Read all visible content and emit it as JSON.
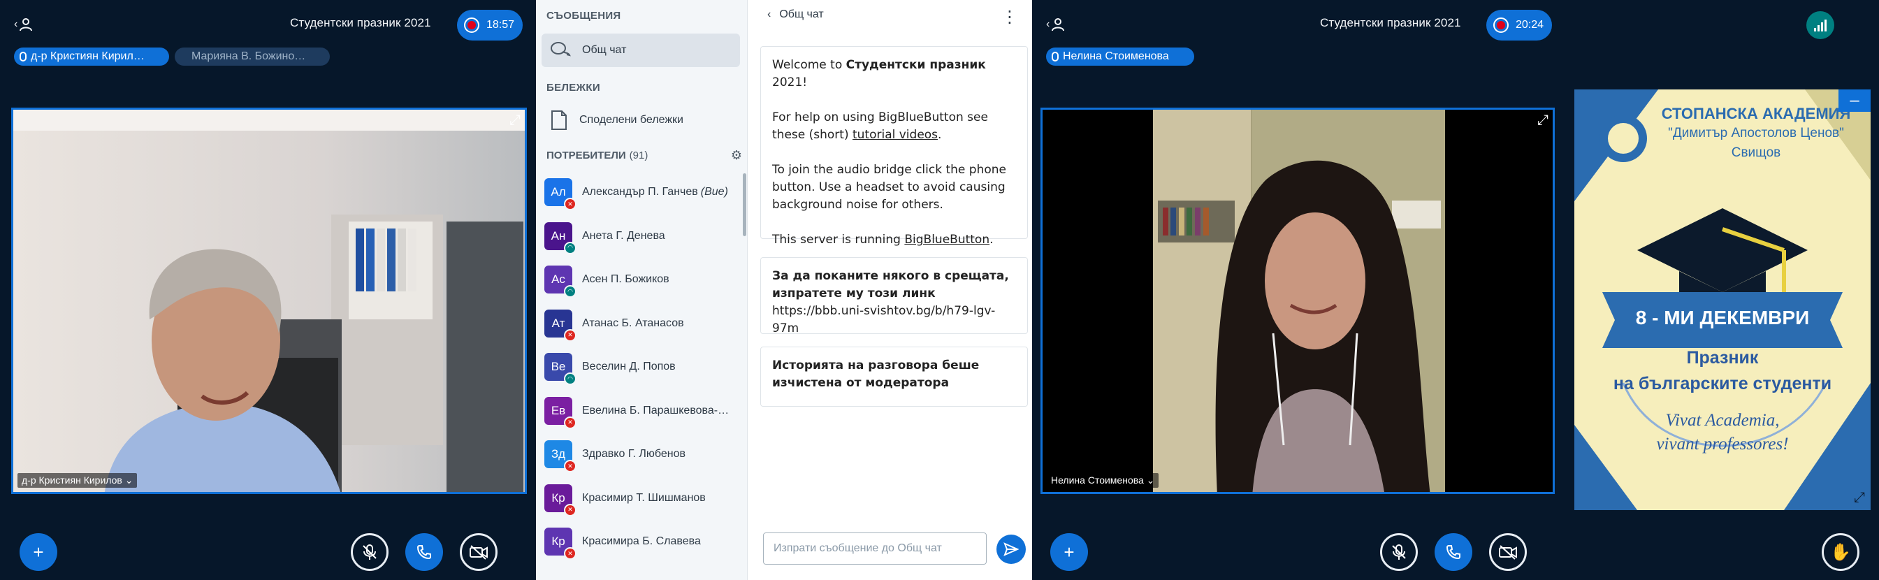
{
  "colors": {
    "primary": "#0f70d7",
    "background": "#06172a",
    "muted": "#de2721",
    "listen": "#008081"
  },
  "left_meeting": {
    "title": "Студентски празник 2021",
    "timer": "18:57",
    "talkers": [
      {
        "name": "д-р Кристиян Кирил…"
      },
      {
        "name": "Марияна В. Божино…"
      }
    ],
    "video_name": "д-р Кристиян Кирилов"
  },
  "sidebar": {
    "messages_section": "СЪОБЩЕНИЯ",
    "public_chat": "Общ чат",
    "notes_section": "БЕЛЕЖКИ",
    "shared_notes": "Споделени бележки",
    "users_section": "ПОТРЕБИТЕЛИ",
    "users_count": "(91)",
    "users": [
      {
        "initials": "Ал",
        "name": "Александър П. Ганчев",
        "suffix": "(Вие)",
        "color": "#1a73e8",
        "status": "muted"
      },
      {
        "initials": "Ан",
        "name": "Анета Г. Денева",
        "suffix": "",
        "color": "#4a148c",
        "status": "listen"
      },
      {
        "initials": "Ас",
        "name": "Асен П. Божиков",
        "suffix": "",
        "color": "#5e35b1",
        "status": "listen"
      },
      {
        "initials": "Ат",
        "name": "Атанас Б. Атанасов",
        "suffix": "",
        "color": "#283593",
        "status": "muted"
      },
      {
        "initials": "Ве",
        "name": "Веселин Д. Попов",
        "suffix": "",
        "color": "#3949ab",
        "status": "listen"
      },
      {
        "initials": "Ев",
        "name": "Евелина Б. Парашкевова-В…",
        "suffix": "",
        "color": "#7b1fa2",
        "status": "muted"
      },
      {
        "initials": "Зд",
        "name": "Здравко Г. Любенов",
        "suffix": "",
        "color": "#1e88e5",
        "status": "muted"
      },
      {
        "initials": "Кр",
        "name": "Красимир Т. Шишманов",
        "suffix": "",
        "color": "#6a1b9a",
        "status": "muted"
      },
      {
        "initials": "Кр",
        "name": "Красимира Б. Славева",
        "suffix": "",
        "color": "#5e35b1",
        "status": "muted"
      }
    ]
  },
  "chat": {
    "header": "Общ чат",
    "welcome": {
      "p1_prefix": "Welcome to ",
      "p1_bold": "Студентски празник",
      "p1_suffix": " 2021!",
      "p2_prefix": "For help on using BigBlueButton see these (short) ",
      "p2_link": "tutorial videos",
      "p2_suffix": ".",
      "p3": "To join the audio bridge click the phone button. Use a headset to avoid causing background noise for others.",
      "p4_prefix": "This server is running ",
      "p4_link": "BigBlueButton",
      "p4_suffix": "."
    },
    "invite_text": "За да поканите някого в срещата, изпратете му този линк",
    "invite_link": "https://bbb.uni-svishtov.bg/b/h79-lgv-97m",
    "cleared_text": "Историята на разговора беше изчистена от модератора",
    "input_placeholder": "Изпрати съобщение до Общ чат"
  },
  "right_meeting": {
    "title": "Студентски празник 2021",
    "timer": "20:24",
    "talker": "Нелина Стоименова",
    "video_name": "Нелина Стоименова"
  },
  "slide": {
    "academy_line1": "СТОПАНСКА АКАДЕМИЯ",
    "academy_line2": "\"Димитър Апостолов Ценов\"",
    "academy_line3": "Свищов",
    "date": "8 - МИ ДЕКЕМВРИ",
    "holiday_line1": "Празник",
    "holiday_line2": "на българските студенти",
    "motto_line1": "Vivat Academia,",
    "motto_line2": "vivant professores!"
  }
}
